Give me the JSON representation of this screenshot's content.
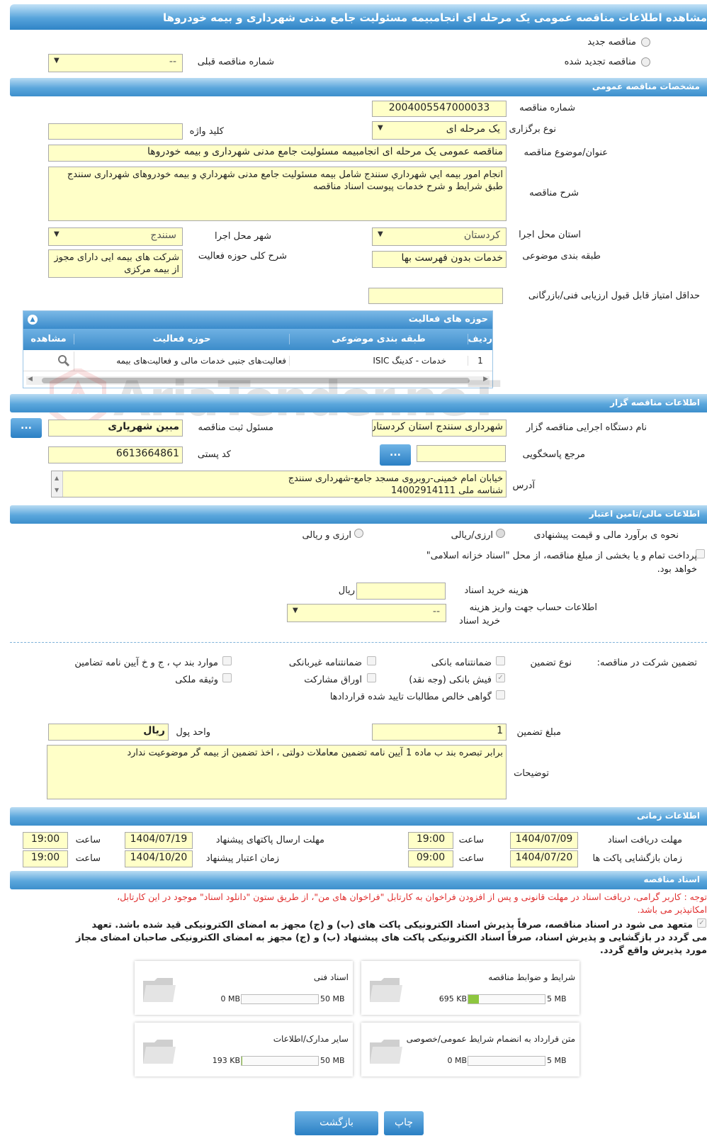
{
  "title": "مشاهده اطلاعات مناقصه عمومی یک مرحله ای انجامبیمه مسئولیت جامع مدنی شهرداری و بیمه خودروها",
  "tender_new": "مناقصه جدید",
  "tender_renewed": "مناقصه تجدید شده",
  "prev_no_label": "شماره مناقصه قبلی",
  "prev_no_value": "--",
  "sec_general": "مشخصات مناقصه عمومی",
  "no_label": "شماره مناقصه",
  "no_value": "2004005547000033",
  "type_label": "نوع برگزاری",
  "type_value": "یک مرحله ای",
  "keyword_label": "کلید واژه",
  "subject_label": "عنوان/موضوع مناقصه",
  "subject_value": "مناقصه عمومی یک مرحله ای انجامبیمه مسئولیت جامع مدنی شهرداری و بیمه خودروها",
  "desc_label": "شرح مناقصه",
  "desc_value": "انجام امور بیمه ایي شهرداري سنندج شامل بیمه مسئولیت جامع مدنی شهرداري و بیمه خودروهای شهرداری سنندج طبق شرایط و شرح خدمات پیوست اسناد مناقصه",
  "province_label": "استان محل اجرا",
  "province_value": "کردستان",
  "city_label": "شهر محل اجرا",
  "city_value": "سنندج",
  "category_label": "طبقه بندی موضوعی",
  "category_value": "خدمات بدون فهرست بها",
  "activity_desc_label": "شرح کلی حوزه فعالیت",
  "activity_desc_value": "شرکت های بیمه ایی دارای مجوز از بیمه مرکزی",
  "min_score_label": "حداقل امتیاز قابل قبول ارزیابی فنی/بازرگانی",
  "activity_panel": {
    "title": "حوزه های فعالیت",
    "headers": [
      "ردیف",
      "طبقه بندی موضوعی",
      "حوزه فعالیت",
      "مشاهده"
    ],
    "row": [
      "1",
      "خدمات - کدینگ ISIC",
      "فعالیت‌های جنبی خدمات مالی و فعالیت‌های بیمه"
    ]
  },
  "watermark": "AriaTender.neT",
  "sec_org": "اطلاعات مناقصه گزار",
  "org_label": "نام دستگاه اجرایی مناقصه گزار",
  "org_value": "شهرداری سنندج استان کردستان",
  "registrar_label": "مسئول ثبت مناقصه",
  "registrar_value": "مبین شهریاری",
  "ref_label": "مرجع پاسخگویی",
  "postal_label": "کد پستی",
  "postal_value": "6613664861",
  "address_label": "آدرس",
  "address_l1": "خیابان امام خمینی-روبروی مسجد جامع-شهرداری سنندج",
  "address_l2": "شناسه ملی 14002914111",
  "dots": "...",
  "sec_fin": "اطلاعات مالی/تامین اعتبار",
  "estimate_label": "نحوه ی برآورد مالی و قیمت پیشنهادی",
  "estimate_opt1": "ارزی/ریالی",
  "estimate_opt2": "ارزی و ریالی",
  "treasury_text1": "پرداخت تمام و یا بخشی از مبلغ مناقصه، از محل \"اسناد خزانه اسلامی\"",
  "treasury_text2": "خواهد بود.",
  "doc_cost_label": "هزینه خرید اسناد",
  "doc_cost_unit": "ریال",
  "account_label1": "اطلاعات حساب جهت واریز هزینه",
  "account_label2": "خرید اسناد",
  "account_value": "--",
  "guarantee_label": "تضمین شرکت در مناقصه:",
  "guarantee_type_label": "نوع تضمین",
  "g_bank": "ضمانتنامه بانکی",
  "g_nonbank": "ضمانتنامه غیربانکی",
  "g_items": "موارد بند پ ، ج و خ آیین نامه تضامین",
  "g_cash": "فیش بانکی (وجه نقد)",
  "g_bonds": "اوراق مشارکت",
  "g_property": "وثیقه ملکی",
  "g_claims": "گواهی خالص مطالبات تایید شده قراردادها",
  "amount_label": "مبلغ تضمین",
  "amount_value": "1",
  "currency_label": "واحد پول",
  "currency_value": "ریال",
  "notes_label": "توضیحات",
  "notes_value": "برابر تبصره بند ب ماده 1 آیین نامه تضمین معاملات دولتی ، اخذ تضمین از بیمه گر موضوعیت ندارد",
  "sec_time": "اطلاعات زمانی",
  "time_label": "ساعت",
  "doc_deadline_label": "مهلت دریافت اسناد",
  "doc_deadline_date": "1404/07/09",
  "doc_deadline_time": "19:00",
  "send_deadline_label": "مهلت ارسال پاکتهای پیشنهاد",
  "send_deadline_date": "1404/07/19",
  "send_deadline_time": "19:00",
  "open_label": "زمان بازگشایی پاکت ها",
  "open_date": "1404/07/20",
  "open_time": "09:00",
  "valid_label": "زمان اعتبار پیشنهاد",
  "valid_date": "1404/10/20",
  "valid_time": "19:00",
  "sec_docs": "اسناد مناقصه",
  "notice1": "توجه : کاربر گرامی، دریافت اسناد در مهلت قانونی و پس از افزودن فراخوان به کارتابل \"فراخوان های من\"، از طریق ستون \"دانلود اسناد\" موجود در این کارتابل،",
  "notice2": "امکانپذیر می باشد.",
  "commit1": "متعهد می شود در اسناد مناقصه، صرفاً پذیرش اسناد الکترونیکی پاکت های (ب) و (ج) مجهز به امضای الکترونیکی قید شده باشد. تعهد",
  "commit2": "می گردد در بازگشایی و پذیرش اسناد، صرفاً اسناد الکترونیکی پاکت های پیشنهاد (ب) و (ج) مجهز به امضای الکترونیکی صاحبان امضای مجاز",
  "commit3": "مورد پذیرش واقع گردد.",
  "docs": [
    {
      "title": "شرایط و ضوابط مناقصه",
      "max": "5 MB",
      "current": "695 KB",
      "ratio": 0.136
    },
    {
      "title": "اسناد فنی",
      "max": "50 MB",
      "current": "0 MB",
      "ratio": 0
    },
    {
      "title": "متن قرارداد به انضمام شرایط عمومی/خصوصی",
      "max": "5 MB",
      "current": "0 MB",
      "ratio": 0
    },
    {
      "title": "سایر مدارک/اطلاعات",
      "max": "50 MB",
      "current": "193 KB",
      "ratio": 0.004
    }
  ],
  "btn_back": "بازگشت",
  "btn_print": "چاپ"
}
